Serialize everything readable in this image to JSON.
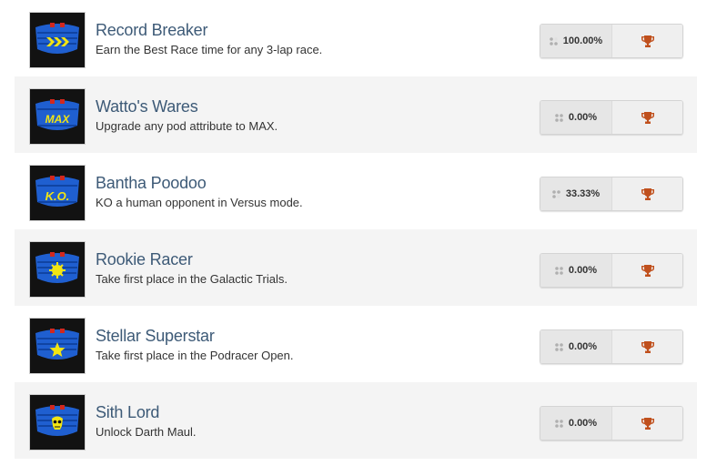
{
  "achievements": [
    {
      "title": "Record Breaker",
      "description": "Earn the Best Race time for any 3-lap race.",
      "percent": "100.00%",
      "icon": "chevrons-icon",
      "icon_label": ""
    },
    {
      "title": "Watto's Wares",
      "description": "Upgrade any pod attribute to MAX.",
      "percent": "0.00%",
      "icon": "max-icon",
      "icon_label": "MAX"
    },
    {
      "title": "Bantha Poodoo",
      "description": "KO a human opponent in Versus mode.",
      "percent": "33.33%",
      "icon": "ko-icon",
      "icon_label": "K.O."
    },
    {
      "title": "Rookie Racer",
      "description": "Take first place in the Galactic Trials.",
      "percent": "0.00%",
      "icon": "sunburst-icon",
      "icon_label": ""
    },
    {
      "title": "Stellar Superstar",
      "description": "Take first place in the Podracer Open.",
      "percent": "0.00%",
      "icon": "star-icon",
      "icon_label": ""
    },
    {
      "title": "Sith Lord",
      "description": "Unlock Darth Maul.",
      "percent": "0.00%",
      "icon": "skull-icon",
      "icon_label": ""
    }
  ],
  "colors": {
    "title": "#3d5a77",
    "trophy": "#c0501d",
    "badge_blue": "#1f5fd0",
    "badge_yellow": "#f3e512"
  }
}
